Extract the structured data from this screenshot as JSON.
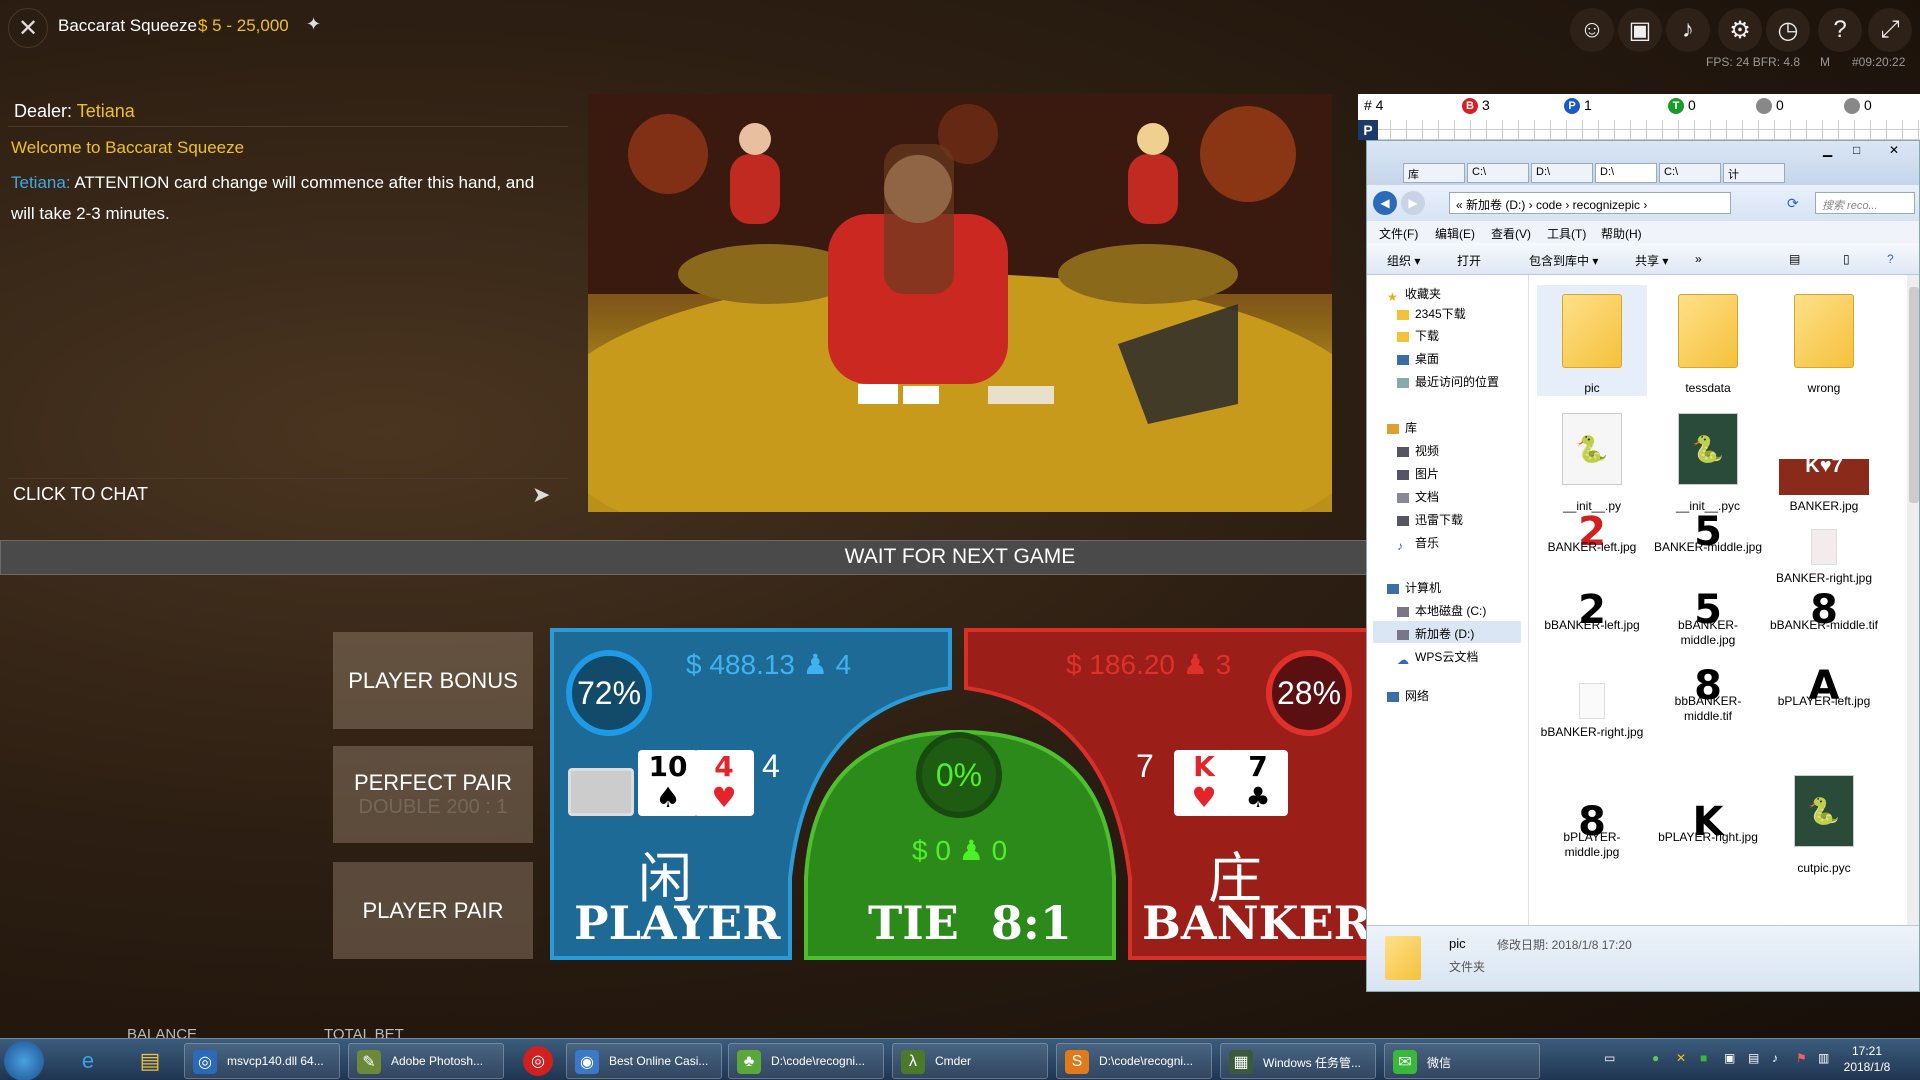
{
  "top": {
    "title": "Baccarat Squeeze",
    "limits": "$ 5 - 25,000",
    "fps_label": "FPS: 24  BFR: 4.8",
    "mode": "M",
    "clock": "#09:20:22"
  },
  "chat": {
    "dealer_label": "Dealer:",
    "dealer_name": "Tetiana",
    "welcome": "Welcome to Baccarat Squeeze",
    "message_author": "Tetiana:",
    "message_text": "ATTENTION card change will commence after this hand, and will take 2-3 minutes.",
    "click_to_chat": "CLICK TO CHAT"
  },
  "status_banner": "WAIT FOR NEXT GAME",
  "side_bets": {
    "player_bonus": "PLAYER BONUS",
    "perfect_pair": "PERFECT PAIR",
    "perfect_pair_sub": "DOUBLE 200 : 1",
    "player_pair": "PLAYER PAIR"
  },
  "player": {
    "amount": "$ 488.13",
    "players": "4",
    "percent": "72%",
    "score": "4",
    "cards": [
      {
        "rank": "10",
        "suit": "♠",
        "red": false
      },
      {
        "rank": "4",
        "suit": "♥",
        "red": true
      }
    ],
    "chinese": "闲",
    "label": "PLAYER"
  },
  "tie": {
    "percent": "0%",
    "amount": "$ 0",
    "players": "0",
    "label": "TIE  8:1"
  },
  "banker": {
    "amount": "$ 186.20",
    "players": "3",
    "percent": "28%",
    "score": "7",
    "cards": [
      {
        "rank": "K",
        "suit": "♥",
        "red": true
      },
      {
        "rank": "7",
        "suit": "♣",
        "red": false
      }
    ],
    "chinese": "庄",
    "label": "BANKER"
  },
  "bottom": {
    "balance_label": "BALANCE",
    "total_bet_label": "TOTAL BET"
  },
  "roadmap": {
    "hash": "# 4",
    "banker_count": "3",
    "player_count": "1",
    "tie_count": "0",
    "pair1_count": "0",
    "pair2_count": "0",
    "row_label": "P"
  },
  "explorer": {
    "tabs": [
      "库",
      "C:\\",
      "D:\\",
      "D:\\",
      "C:\\",
      "计"
    ],
    "path": "« 新加卷 (D:) › code › recognizepic ›",
    "search_placeholder": "搜索 reco...",
    "menu": [
      "文件(F)",
      "编辑(E)",
      "查看(V)",
      "工具(T)",
      "帮助(H)"
    ],
    "toolbar": [
      "组织 ▾",
      "打开",
      "包含到库中 ▾",
      "共享 ▾",
      "»"
    ],
    "nav": {
      "favorites": "收藏夹",
      "fav_items": [
        "2345下载",
        "下载",
        "桌面",
        "最近访问的位置"
      ],
      "library": "库",
      "lib_items": [
        "视频",
        "图片",
        "文档",
        "迅雷下载",
        "音乐"
      ],
      "computer": "计算机",
      "comp_items": [
        "本地磁盘 (C:)",
        "新加卷 (D:)",
        "WPS云文档"
      ],
      "network": "网络"
    },
    "files": [
      {
        "name": "pic",
        "glyph": "",
        "kind": "folder"
      },
      {
        "name": "tessdata",
        "glyph": "",
        "kind": "folder"
      },
      {
        "name": "wrong",
        "glyph": "",
        "kind": "folder"
      },
      {
        "name": "__init__.py",
        "glyph": "🐍",
        "kind": "py"
      },
      {
        "name": "__init__.pyc",
        "glyph": "🐍",
        "kind": "py"
      },
      {
        "name": "BANKER.jpg",
        "glyph": "K♥7",
        "kind": "img"
      },
      {
        "name": "BANKER-left.jpg",
        "glyph": "2",
        "kind": "glyph",
        "red": true
      },
      {
        "name": "BANKER-middle.jpg",
        "glyph": "5",
        "kind": "glyph"
      },
      {
        "name": "BANKER-right.jpg",
        "glyph": "",
        "kind": "glyph"
      },
      {
        "name": "bBANKER-left.jpg",
        "glyph": "2",
        "kind": "glyph"
      },
      {
        "name": "bBANKER-middle.jpg",
        "glyph": "5",
        "kind": "glyph"
      },
      {
        "name": "bBANKER-middle.tif",
        "glyph": "8",
        "kind": "glyph"
      },
      {
        "name": "bBANKER-right.jpg",
        "glyph": "",
        "kind": "glyph"
      },
      {
        "name": "bbBANKER-middle.tif",
        "glyph": "8",
        "kind": "glyph"
      },
      {
        "name": "bPLAYER-left.jpg",
        "glyph": "A",
        "kind": "glyph"
      },
      {
        "name": "bPLAYER-middle.jpg",
        "glyph": "8",
        "kind": "glyph"
      },
      {
        "name": "bPLAYER-right.jpg",
        "glyph": "K",
        "kind": "glyph"
      },
      {
        "name": "cutpic.pyc",
        "glyph": "🐍",
        "kind": "py"
      }
    ],
    "status_name": "pic",
    "status_date": "修改日期: 2018/1/8 17:20",
    "status_type": "文件夹"
  },
  "taskbar": {
    "apps": [
      {
        "label": "msvcp140.dll 64...",
        "icon": "◎"
      },
      {
        "label": "Adobe Photosh...",
        "icon": "✎"
      },
      {
        "label": "Best Online Casi...",
        "icon": "◉"
      },
      {
        "label": "D:\\code\\recogni...",
        "icon": "♣"
      },
      {
        "label": "Cmder",
        "icon": "λ"
      },
      {
        "label": "D:\\code\\recogni...",
        "icon": "S"
      },
      {
        "label": "Windows 任务管...",
        "icon": "▦"
      },
      {
        "label": "微信",
        "icon": "✉"
      }
    ],
    "time": "17:21",
    "date": "2018/1/8"
  },
  "colors": {
    "player_blue": "#1d6e9a",
    "banker_red": "#a8221c",
    "tie_green": "#2f8a1e",
    "gold": "#f0c020",
    "chat_blue": "#3fa9e6"
  }
}
